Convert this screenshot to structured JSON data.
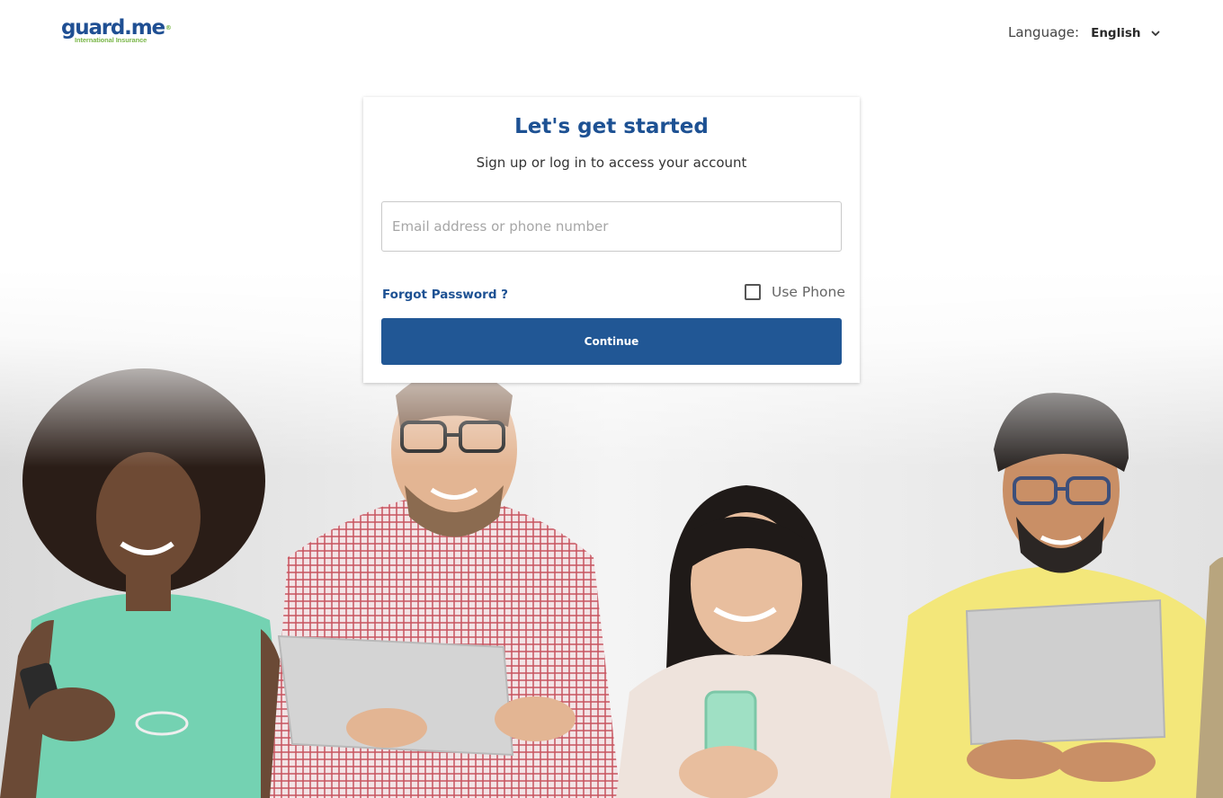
{
  "header": {
    "logo": {
      "wordmark_main": "guard",
      "wordmark_dot": ".me",
      "wordmark_reg": "®",
      "tagline": "International Insurance"
    },
    "language": {
      "label": "Language:",
      "selected": "English",
      "icon": "chevron-down-icon"
    }
  },
  "login_card": {
    "title": "Let's get started",
    "subtitle": "Sign up or log in to access your account",
    "identifier_input": {
      "value": "",
      "placeholder": "Email address or phone number"
    },
    "forgot_password_link": "Forgot Password ?",
    "use_phone": {
      "label": "Use Phone",
      "checked": false
    },
    "continue_button": "Continue"
  },
  "colors": {
    "brand_blue": "#1d5193",
    "button_blue": "#215795",
    "brand_green": "#7ab648",
    "text_dark": "#333333",
    "text_muted": "#666666"
  },
  "background": {
    "description_icon": "people-with-devices-photo"
  }
}
